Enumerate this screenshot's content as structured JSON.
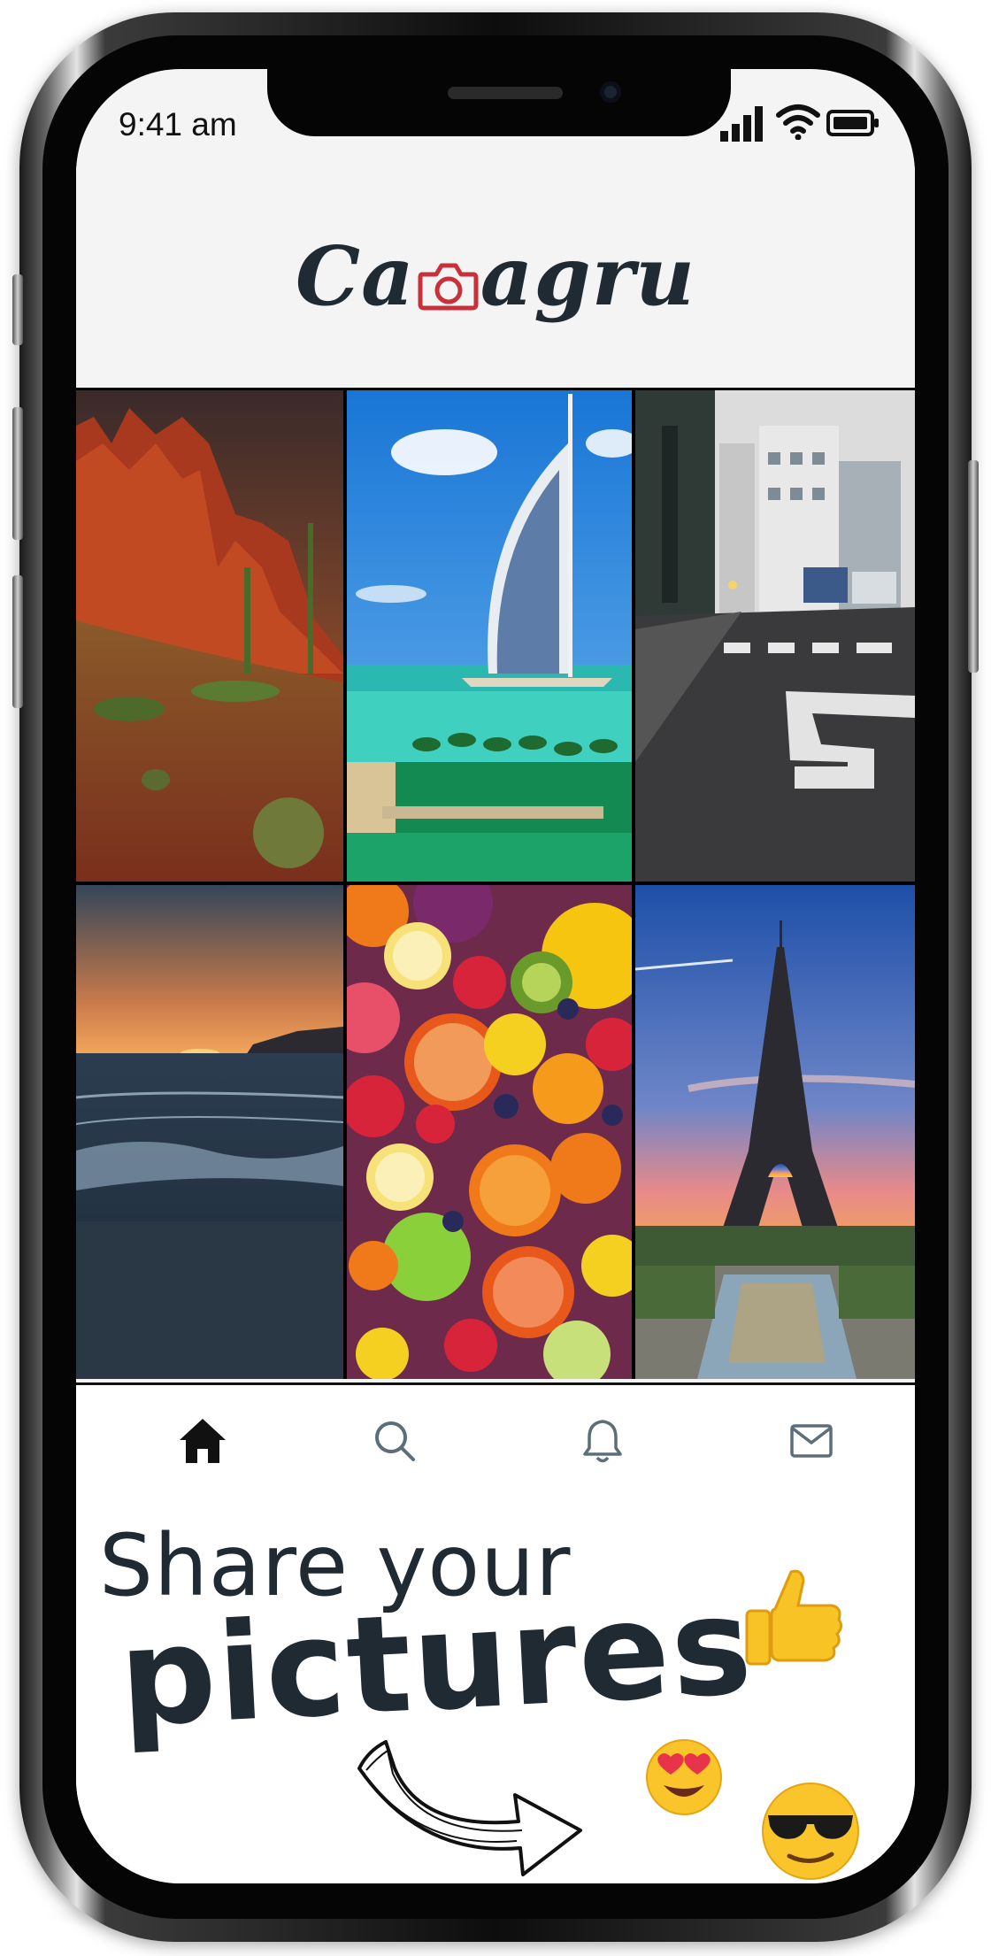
{
  "status_bar": {
    "time": "9:41 am",
    "icons": [
      "signal-icon",
      "wifi-icon",
      "battery-icon"
    ]
  },
  "app": {
    "logo_text_left": "Ca",
    "logo_text_right": "agru",
    "logo_camera_icon": "camera-icon",
    "accent": "#c8313a"
  },
  "grid": {
    "photos": [
      {
        "subject": "desert-mesa"
      },
      {
        "subject": "burj-al-arab"
      },
      {
        "subject": "city-street"
      },
      {
        "subject": "ocean-sunset"
      },
      {
        "subject": "fruit-assortment"
      },
      {
        "subject": "eiffel-tower"
      }
    ]
  },
  "tabbar": {
    "tabs": [
      {
        "icon": "home-icon",
        "active": true
      },
      {
        "icon": "search-icon",
        "active": false
      },
      {
        "icon": "bell-icon",
        "active": false
      },
      {
        "icon": "mail-icon",
        "active": false
      }
    ]
  },
  "promo": {
    "line1": "Share your",
    "line2": "pictures",
    "emojis": [
      "thumbs-up-icon",
      "heart-eyes-icon",
      "sunglasses-face-icon"
    ]
  }
}
